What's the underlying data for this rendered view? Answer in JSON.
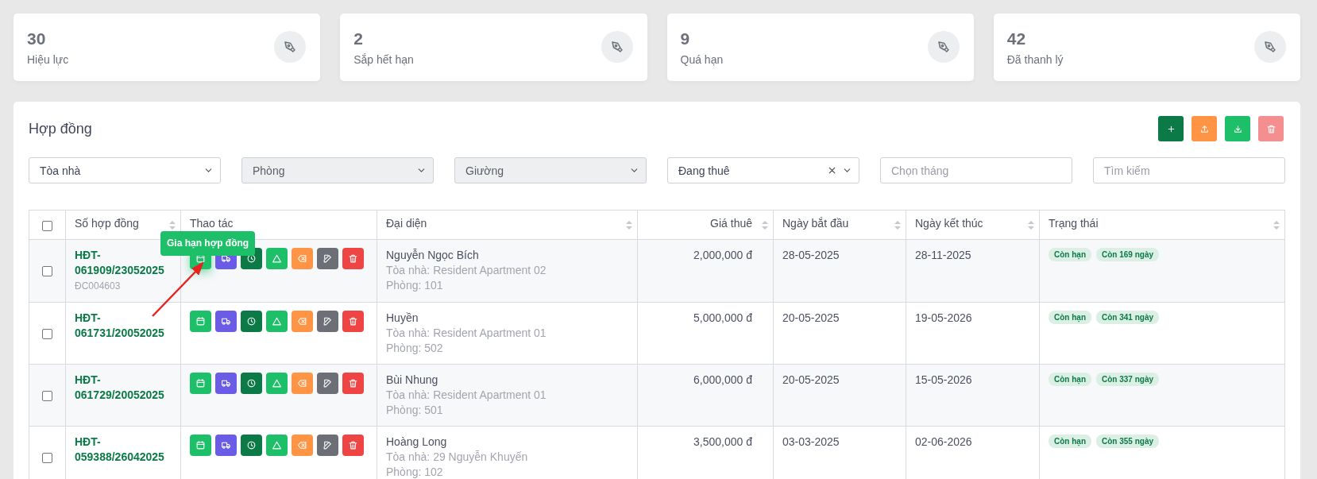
{
  "stats": [
    {
      "value": "30",
      "label": "Hiệu lực"
    },
    {
      "value": "2",
      "label": "Sắp hết hạn"
    },
    {
      "value": "9",
      "label": "Quá hạn"
    },
    {
      "value": "42",
      "label": "Đã thanh lý"
    }
  ],
  "panel": {
    "title": "Hợp đồng",
    "toolbar": [
      {
        "kind": "add",
        "disabled": false
      },
      {
        "kind": "import",
        "disabled": false
      },
      {
        "kind": "export",
        "disabled": false
      },
      {
        "kind": "delete",
        "disabled": true
      }
    ],
    "filters": [
      {
        "kind": "select",
        "value": "Tòa nhà",
        "disabled": false,
        "clearable": false
      },
      {
        "kind": "select",
        "value": "Phòng",
        "disabled": true,
        "clearable": false
      },
      {
        "kind": "select",
        "value": "Giường",
        "disabled": true,
        "clearable": false
      },
      {
        "kind": "select",
        "value": "Đang thuê",
        "disabled": false,
        "clearable": true
      },
      {
        "kind": "input",
        "placeholder": "Chọn tháng"
      },
      {
        "kind": "input",
        "placeholder": "Tìm kiếm"
      }
    ]
  },
  "table": {
    "select_all": {
      "checked": false
    },
    "columns": [
      {
        "label": "Số hợp đồng",
        "sortable": true
      },
      {
        "label": "Thao tác",
        "sortable": false
      },
      {
        "label": "Đại diện",
        "sortable": true
      },
      {
        "label": "Giá thuê",
        "sortable": true
      },
      {
        "label": "Ngày bắt đầu",
        "sortable": true
      },
      {
        "label": "Ngày kết thúc",
        "sortable": true
      },
      {
        "label": "Trạng thái",
        "sortable": true
      }
    ],
    "rows": [
      {
        "checked": false,
        "contract": "HĐT-061909/23052025",
        "code": "ĐC004603",
        "tooltip": "Gia hạn hợp đồng",
        "name": "Nguyễn Ngọc Bích",
        "building": "Tòa nhà: Resident Apartment 02",
        "room": "Phòng: 101",
        "price": "2,000,000 đ",
        "start": "28-05-2025",
        "end": "28-11-2025",
        "badges": [
          "Còn hạn",
          "Còn 169 ngày"
        ]
      },
      {
        "checked": false,
        "contract": "HĐT-061731/20052025",
        "name": "Huyền",
        "building": "Tòa nhà: Resident Apartment 01",
        "room": "Phòng: 502",
        "price": "5,000,000 đ",
        "start": "20-05-2025",
        "end": "19-05-2026",
        "badges": [
          "Còn hạn",
          "Còn 341 ngày"
        ]
      },
      {
        "checked": false,
        "contract": "HĐT-061729/20052025",
        "name": "Bùi Nhung",
        "building": "Tòa nhà: Resident Apartment 01",
        "room": "Phòng: 501",
        "price": "6,000,000 đ",
        "start": "20-05-2025",
        "end": "15-05-2026",
        "badges": [
          "Còn hạn",
          "Còn 337 ngày"
        ]
      },
      {
        "checked": false,
        "contract": "HĐT-059388/26042025",
        "name": "Hoàng Long",
        "building": "Tòa nhà: 29 Nguyễn Khuyến",
        "room": "Phòng: 102",
        "price": "3,500,000 đ",
        "start": "03-03-2025",
        "end": "02-06-2026",
        "badges": [
          "Còn hạn",
          "Còn 355 ngày"
        ]
      }
    ]
  }
}
